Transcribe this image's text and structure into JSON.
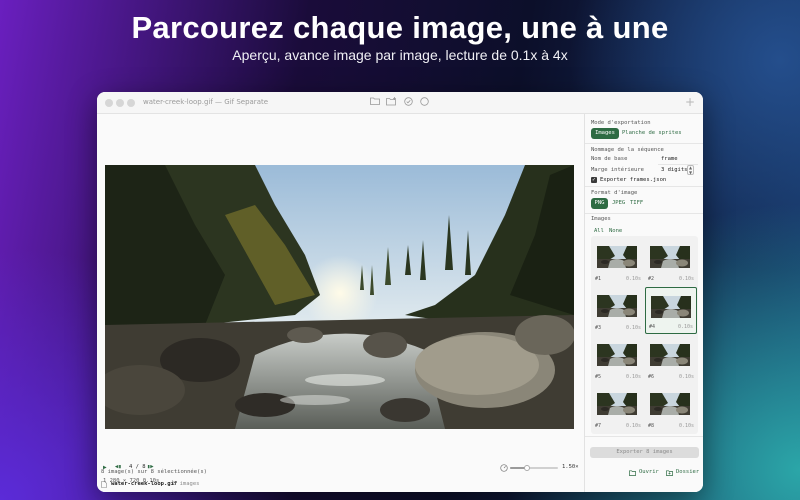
{
  "headline": "Parcourez chaque image, une à une",
  "subline": "Aperçu, avance image par image, lecture de 0.1x à 4x",
  "window": {
    "title": "water-creek-loop.gif — Gif Separate",
    "toolbar_icons": [
      "folder-icon",
      "folder-plus-icon",
      "check-circle-icon",
      "circle-icon"
    ],
    "add_label": "+"
  },
  "player": {
    "play": "▶",
    "prev": "◀▮",
    "frame_counter": "4 / 8",
    "next": "▮▶",
    "info": "1 280 × 720  0.10s",
    "speed_value": 0.35,
    "speed_label": "1.50×",
    "selection_status": "8 image(s) sur 8 sélectionnée(s)"
  },
  "statusbar": {
    "file": "water-creek-loop.gif",
    "count": "8 images"
  },
  "sidebar": {
    "export_mode_label": "Mode d'exportation",
    "mode_images": "Images",
    "mode_sprites": "Planche de sprites",
    "naming_label": "Nommage de la séquence",
    "basename_label": "Nom de base",
    "basename_value": "frame",
    "padding_label": "Marge intérieure",
    "padding_value": "3 digits",
    "export_json": "Exporter frames.json",
    "format_label": "Format d'image",
    "formats": [
      "PNG",
      "JPEG",
      "TIFF"
    ],
    "images_label": "Images",
    "select_all": "All",
    "select_none": "None",
    "frames": [
      {
        "num": "#1",
        "dur": "0.10s"
      },
      {
        "num": "#2",
        "dur": "0.10s"
      },
      {
        "num": "#3",
        "dur": "0.10s"
      },
      {
        "num": "#4",
        "dur": "0.10s"
      },
      {
        "num": "#5",
        "dur": "0.10s"
      },
      {
        "num": "#6",
        "dur": "0.10s"
      },
      {
        "num": "#7",
        "dur": "0.10s"
      },
      {
        "num": "#8",
        "dur": "0.10s"
      }
    ],
    "export_button": "Exporter 8 images",
    "open_label": "Ouvrir",
    "folder_label": "Dossier"
  }
}
